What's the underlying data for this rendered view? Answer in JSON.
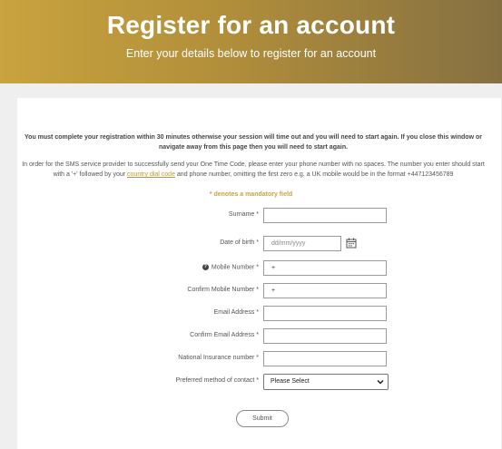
{
  "header": {
    "title": "Register for an account",
    "subtitle": "Enter your details below to register for an account"
  },
  "notice": {
    "warning": "You must complete your registration within 30 minutes otherwise your session will time out and you will need to start again. If you close this window or navigate away from this page then you will need to start again.",
    "info_before": "In order for the SMS service provider to successfully send your One Time Code, please enter your phone number with no spaces. The number you enter should start with a '+' followed by your ",
    "info_link": "country dial code",
    "info_after": " and phone number, omitting the first zero e.g. a UK mobile would be in the format +447123456789"
  },
  "form": {
    "mandatory_note": "* denotes a mandatory field",
    "fields": [
      {
        "label": "Surname *",
        "value": ""
      },
      {
        "label": "Date of birth *",
        "placeholder": "dd/mm/yyyy"
      },
      {
        "label": "Mobile Number *",
        "value": "+"
      },
      {
        "label": "Confirm Mobile Number *",
        "value": "+"
      },
      {
        "label": "Email Address *",
        "value": ""
      },
      {
        "label": "Confirm Email Address *",
        "value": ""
      },
      {
        "label": "National Insurance number *",
        "value": ""
      },
      {
        "label": "Preferred method of contact *",
        "selected": "Please Select"
      }
    ],
    "submit_label": "Submit"
  },
  "colors": {
    "banner_start": "#c9a33e",
    "banner_end": "#857042",
    "accent": "#c9a33e"
  },
  "icons": {
    "help": "question-circle-icon",
    "calendar": "calendar-icon",
    "dropdown": "chevron-down-icon"
  }
}
